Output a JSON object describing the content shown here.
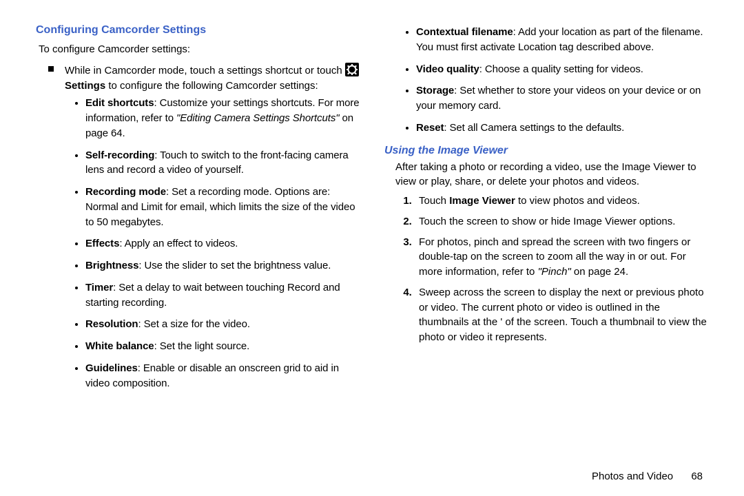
{
  "left": {
    "heading": "Configuring Camcorder Settings",
    "intro": "To configure Camcorder settings:",
    "square_pre": "While in Camcorder mode, touch a settings shortcut or touch ",
    "settings_word": "Settings",
    "square_post": " to configure the following Camcorder settings:",
    "bullets": [
      {
        "term": "Edit shortcuts",
        "text": ": Customize your settings shortcuts. For more information, refer to ",
        "ref": "\"Editing Camera Settings Shortcuts\"",
        "tail": " on page 64."
      },
      {
        "term": "Self-recording",
        "text": ": Touch to switch to the front-facing camera lens and record a video of yourself."
      },
      {
        "term": "Recording mode",
        "text": ": Set a recording mode. Options are: Normal and Limit for email, which limits the size of the video to 50 megabytes."
      },
      {
        "term": "Effects",
        "text": ": Apply an effect to videos."
      },
      {
        "term": "Brightness",
        "text": ": Use the slider to set the brightness value."
      },
      {
        "term": "Timer",
        "text": ": Set a delay to wait between touching Record and starting recording."
      },
      {
        "term": "Resolution",
        "text": ": Set a size for the video."
      },
      {
        "term": "White balance",
        "text": ": Set the light source."
      },
      {
        "term": "Guidelines",
        "text": ": Enable or disable an onscreen grid to aid in video composition."
      }
    ]
  },
  "right": {
    "bullets_top": [
      {
        "term": "Contextual filename",
        "text": ": Add your location as part of the filename. You must first activate Location tag described above."
      },
      {
        "term": "Video quality",
        "text": ": Choose a quality setting for videos."
      },
      {
        "term": "Storage",
        "text": ": Set whether to store your videos on your device or on your memory card."
      },
      {
        "term": "Reset",
        "text": ": Set all Camera settings to the defaults."
      }
    ],
    "heading": "Using the Image Viewer",
    "intro": "After taking a photo or recording a video, use the Image Viewer to view or play, share, or delete your photos and videos.",
    "steps": [
      {
        "pre": "Touch ",
        "bold": "Image Viewer",
        "post": " to view photos and videos."
      },
      {
        "text": "Touch the screen to show or hide Image Viewer options."
      },
      {
        "pre": "For photos, pinch and spread the screen with two fingers or double-tap on the screen to zoom all the way in or out. For more information, refer to ",
        "ref": "\"Pinch\"",
        "post": " on page 24."
      },
      {
        "text": "Sweep across the screen to display the next or previous photo or video. The current photo or video is outlined in the thumbnails at the ' of the screen. Touch a thumbnail to view the photo or video it represents."
      }
    ]
  },
  "footer": {
    "section": "Photos and Video",
    "page": "68"
  }
}
